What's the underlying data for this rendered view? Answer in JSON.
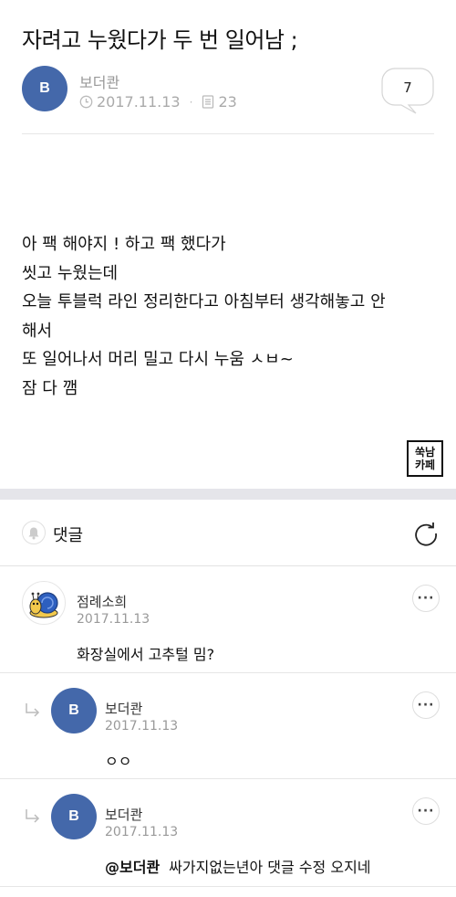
{
  "post": {
    "title": "자려고 누웠다가 두 번 일어남 ;",
    "author": "보더콴",
    "author_initial": "B",
    "date": "2017.11.13",
    "views": "23",
    "comment_count": "7",
    "body_lines": [
      "아 팩 해야지 ! 하고 팩 했다가",
      "씻고 누웠는데",
      "오늘 투블럭 라인 정리한다고 아침부터 생각해놓고 안",
      "해서",
      "또 일어나서 머리 밀고 다시 누움 ㅅㅂ~",
      "잠 다 깸"
    ],
    "watermark": [
      "쑥남",
      "카페"
    ]
  },
  "comments_section": {
    "title": "댓글"
  },
  "comments": [
    {
      "author": "점례소희",
      "date": "2017.11.13",
      "text": "화장실에서 고추털 밈?",
      "mention": "",
      "is_reply": false,
      "avatar": "snail-avatar"
    },
    {
      "author": "보더콴",
      "author_initial": "B",
      "date": "2017.11.13",
      "text": "ㅇㅇ",
      "mention": "",
      "is_reply": true
    },
    {
      "author": "보더콴",
      "author_initial": "B",
      "date": "2017.11.13",
      "text": "싸가지없는년아 댓글 수정 오지네",
      "mention": "@보더콴",
      "is_reply": true
    }
  ],
  "colors": {
    "avatar": "#4468aa",
    "meta_gray": "#aaaaaa",
    "section_gap": "#e5e5ea"
  },
  "icons": {
    "clock": "clock-icon",
    "views": "document-icon",
    "bell": "bell-icon",
    "refresh": "refresh-icon",
    "more": "more-icon",
    "reply": "reply-arrow-icon"
  }
}
